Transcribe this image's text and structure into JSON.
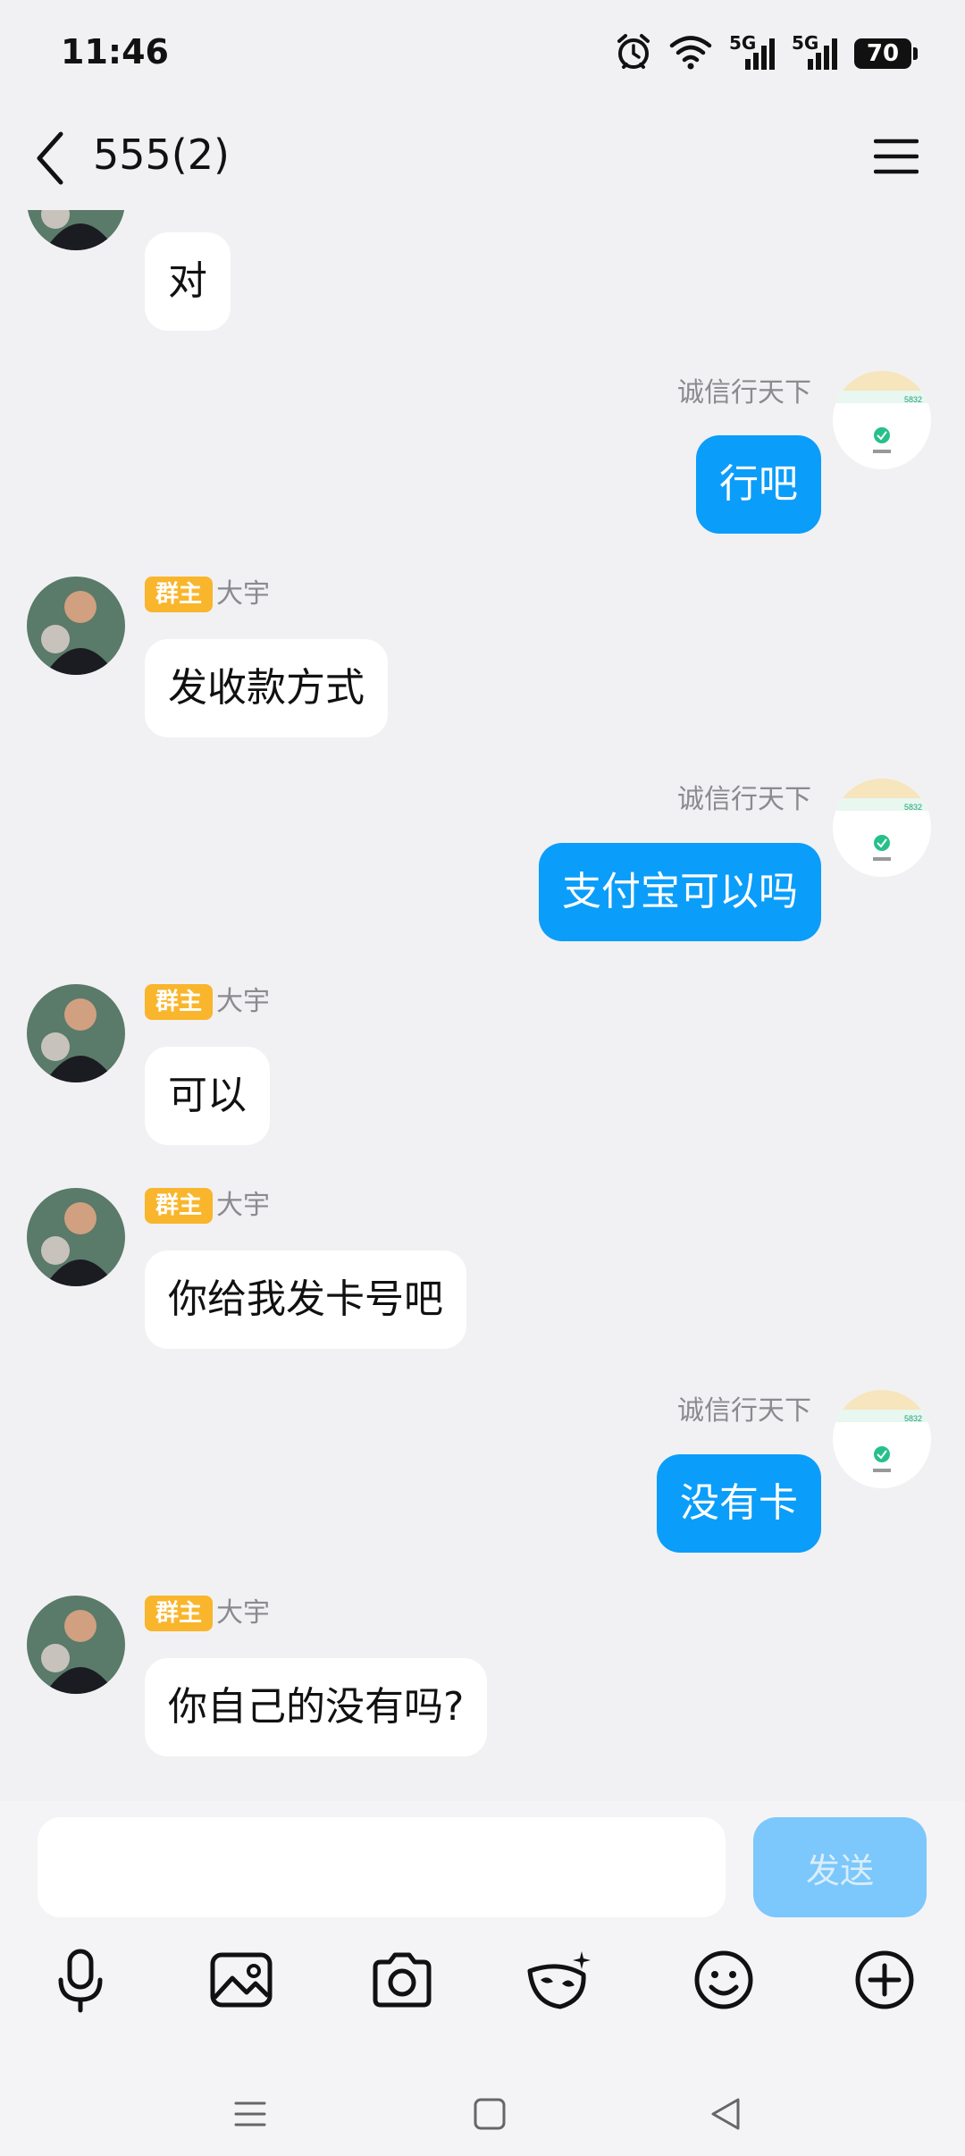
{
  "status_bar": {
    "time": "11:46",
    "sim1": "5G",
    "sim2": "5G",
    "battery": "70"
  },
  "header": {
    "title": "555(2)"
  },
  "messages": [
    {
      "side": "in",
      "show_name": false,
      "text": "对"
    },
    {
      "side": "out",
      "name": "诚信行天下",
      "text": "行吧"
    },
    {
      "side": "in",
      "badge": "群主",
      "name": "大宇",
      "text": "发收款方式"
    },
    {
      "side": "out",
      "name": "诚信行天下",
      "text": "支付宝可以吗"
    },
    {
      "side": "in",
      "badge": "群主",
      "name": "大宇",
      "text": "可以"
    },
    {
      "side": "in",
      "badge": "群主",
      "name": "大宇",
      "text": "你给我发卡号吧"
    },
    {
      "side": "out",
      "name": "诚信行天下",
      "text": "没有卡"
    },
    {
      "side": "in",
      "badge": "群主",
      "name": "大宇",
      "text": "你自己的没有吗?"
    }
  ],
  "avatar_card_text": "5832",
  "input": {
    "value": "",
    "send_label": "发送"
  },
  "toolbar": [
    "mic-icon",
    "image-icon",
    "camera-icon",
    "mask-icon",
    "emoji-icon",
    "plus-icon"
  ],
  "colors": {
    "background": "#f1f1f3",
    "outgoing_bubble": "#0b9dfa",
    "badge": "#f9b52c",
    "send_disabled": "#7cc7fb"
  }
}
